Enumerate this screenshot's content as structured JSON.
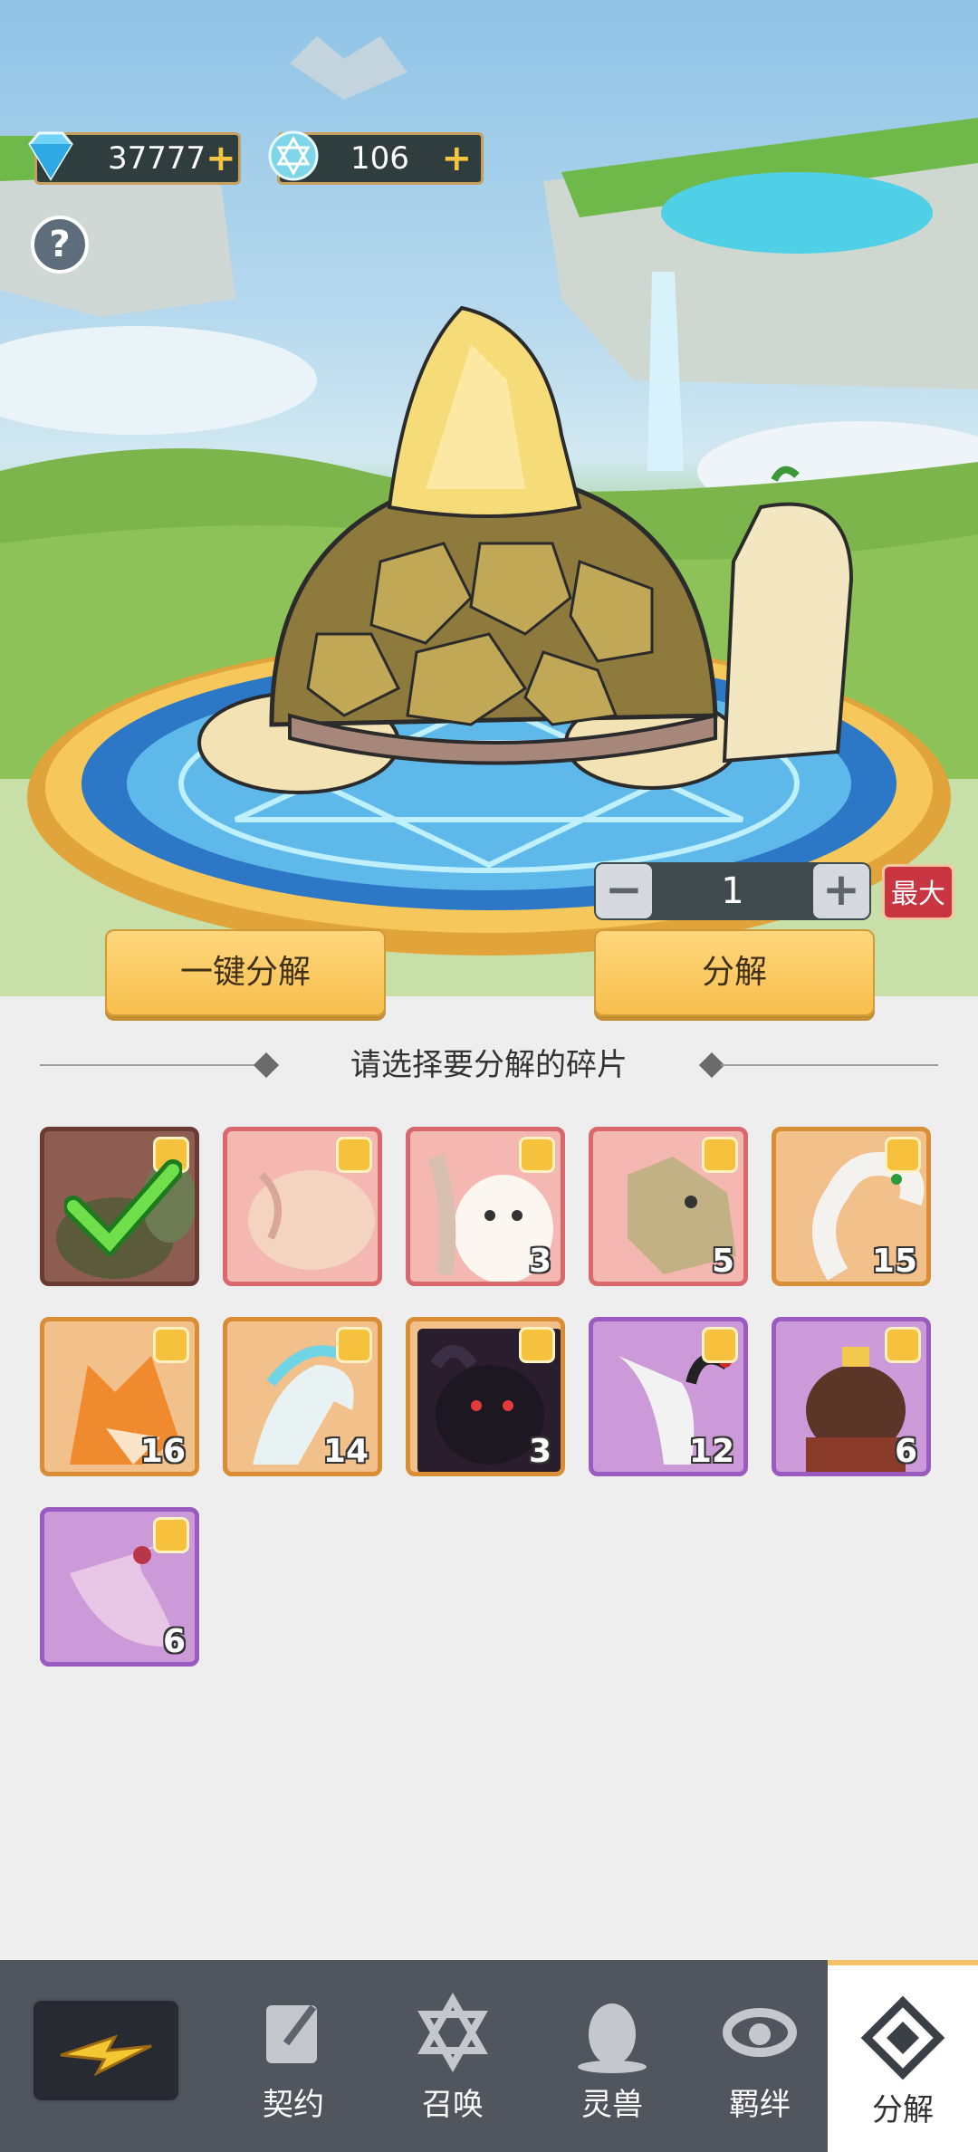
{
  "resources": {
    "diamonds": {
      "icon": "diamond-icon",
      "value": "37777",
      "add": "+"
    },
    "stars": {
      "icon": "star-crystal-icon",
      "value": "106",
      "add": "+"
    }
  },
  "help": {
    "icon": "question-icon",
    "label": "?"
  },
  "beast": {
    "name_icon": "turtle-beast-icon"
  },
  "quantity": {
    "minus": "−",
    "value": "1",
    "plus": "+",
    "max_label": "最大"
  },
  "actions": {
    "one_click_label": "一键分解",
    "decompose_label": "分解"
  },
  "section_title": "请选择要分解的碎片",
  "fragments": [
    {
      "name": "turtle",
      "icon": "turtle-fragment-icon",
      "count": "",
      "rarity": "brown",
      "selected": true
    },
    {
      "name": "pig",
      "icon": "pig-fragment-icon",
      "count": "",
      "rarity": "pink"
    },
    {
      "name": "cat",
      "icon": "cat-fragment-icon",
      "count": "3",
      "rarity": "pink"
    },
    {
      "name": "dragon",
      "icon": "dragon-fragment-icon",
      "count": "5",
      "rarity": "pink"
    },
    {
      "name": "snake",
      "icon": "snake-fragment-icon",
      "count": "15",
      "rarity": "orange"
    },
    {
      "name": "fox",
      "icon": "fox-fragment-icon",
      "count": "16",
      "rarity": "orange"
    },
    {
      "name": "unicorn",
      "icon": "unicorn-fragment-icon",
      "count": "14",
      "rarity": "orange"
    },
    {
      "name": "ox",
      "icon": "ox-fragment-icon",
      "count": "3",
      "rarity": "orange"
    },
    {
      "name": "crane",
      "icon": "crane-fragment-icon",
      "count": "12",
      "rarity": "purple"
    },
    {
      "name": "head",
      "icon": "bun-head-fragment-icon",
      "count": "6",
      "rarity": "purple"
    },
    {
      "name": "bird",
      "icon": "pink-bird-fragment-icon",
      "count": "6",
      "rarity": "purple"
    }
  ],
  "nav": {
    "back_icon": "lightning-back-icon",
    "items": [
      {
        "label": "契约",
        "icon": "contract-icon"
      },
      {
        "label": "召唤",
        "icon": "summon-icon"
      },
      {
        "label": "灵兽",
        "icon": "egg-icon"
      },
      {
        "label": "羁绊",
        "icon": "bond-icon"
      },
      {
        "label": "分解",
        "icon": "decompose-icon",
        "active": true
      }
    ]
  },
  "colors": {
    "button": "#f7bf4d",
    "max_button": "#c8343f",
    "navbar": "#50555e"
  }
}
